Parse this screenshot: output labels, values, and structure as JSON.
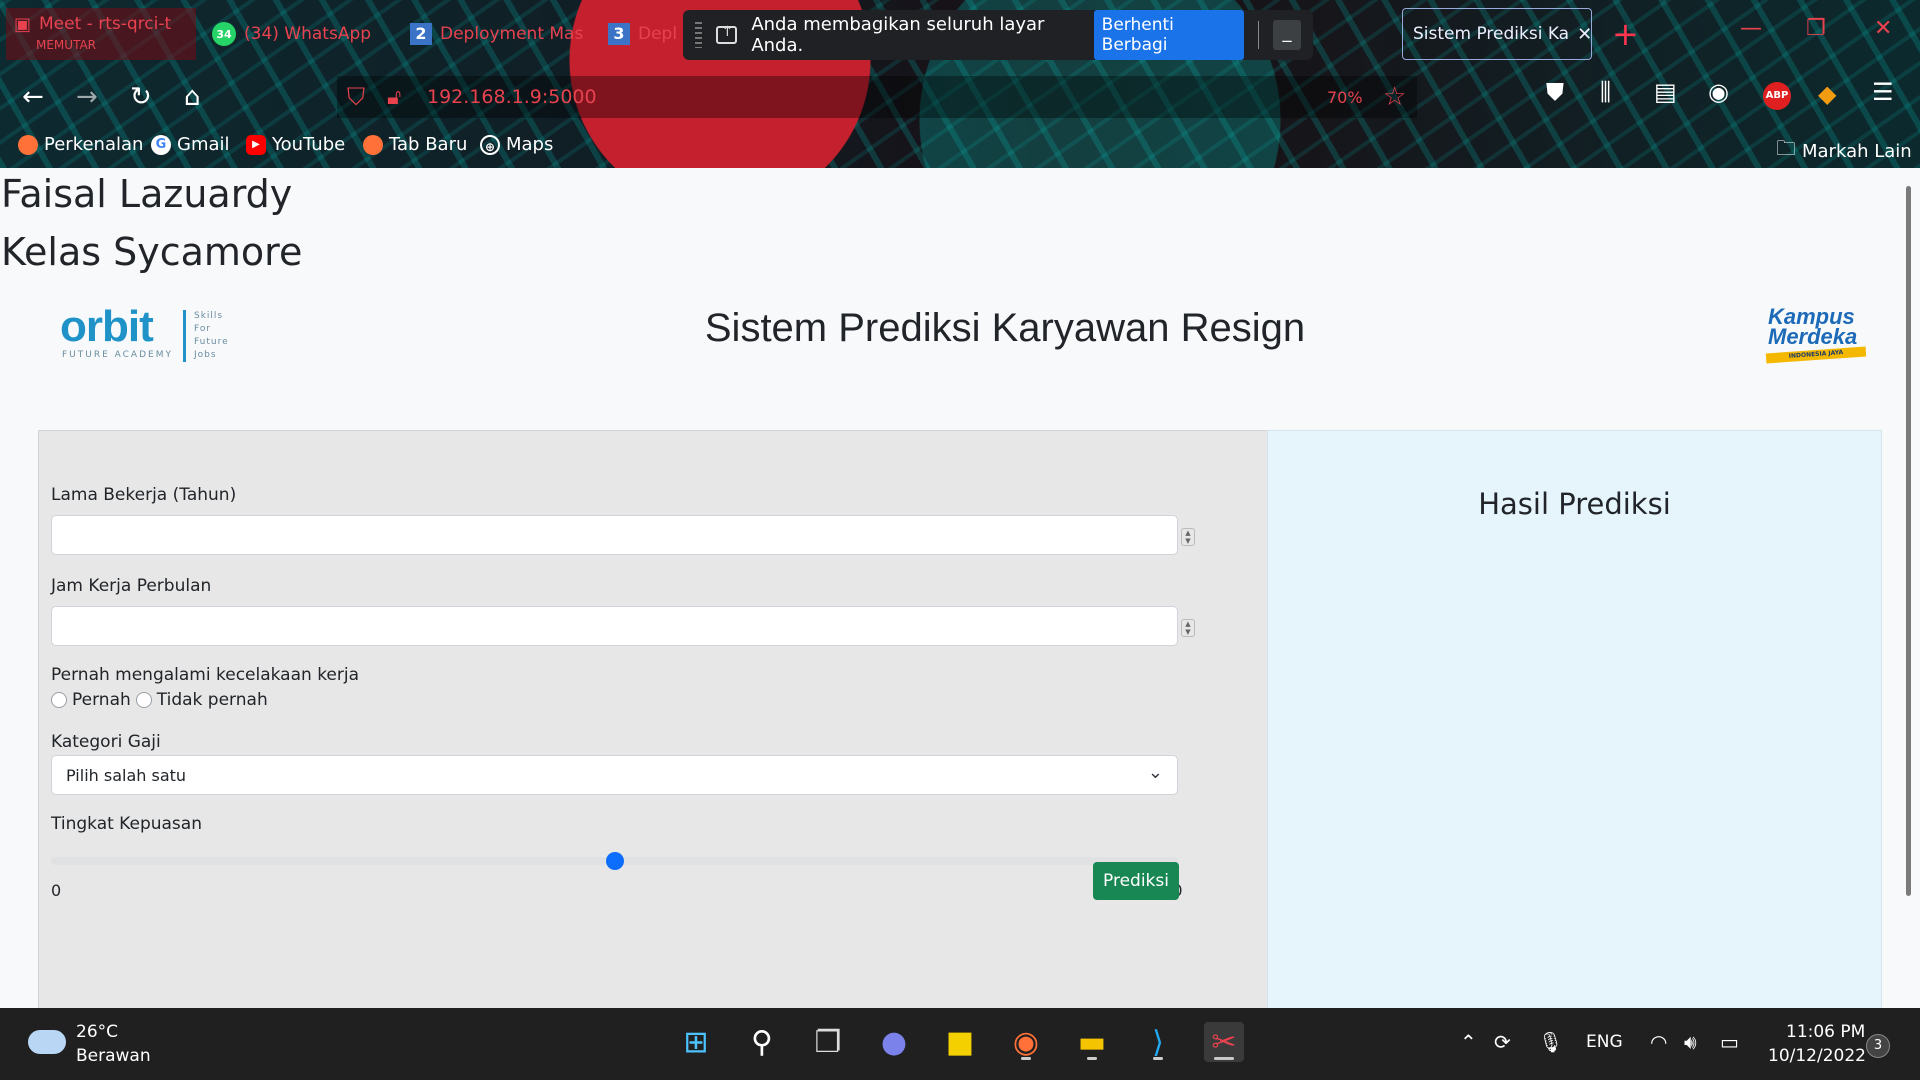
{
  "browser": {
    "tabs": [
      {
        "title": "Meet - rts-qrci-t",
        "subtitle": "MEMUTAR"
      },
      {
        "title": "(34) WhatsApp",
        "badge": "34"
      },
      {
        "title": "Deployment Mas",
        "number": "2"
      },
      {
        "title": "Depl",
        "number": "3"
      },
      {
        "title": "Sistem Prediksi Ka",
        "active": true
      }
    ],
    "share_notice": {
      "message": "Anda membagikan seluruh layar Anda.",
      "stop_label": "Berhenti Berbagi",
      "minimize_label": "_"
    },
    "address": {
      "url": "192.168.1.9:5000",
      "zoom": "70%"
    },
    "bookmarks": [
      {
        "label": "Perkenalan",
        "icon": "firefox-icon"
      },
      {
        "label": "Gmail",
        "icon": "google-icon"
      },
      {
        "label": "YouTube",
        "icon": "youtube-icon"
      },
      {
        "label": "Tab Baru",
        "icon": "firefox-icon"
      },
      {
        "label": "Maps",
        "icon": "globe-icon"
      }
    ],
    "other_bookmarks": "Markah Lain"
  },
  "page": {
    "author_name": "Faisal Lazuardy",
    "author_class": "Kelas Sycamore",
    "title": "Sistem Prediksi Karyawan Resign",
    "logo_left": {
      "word": "orbit",
      "sub": "FUTURE ACADEMY",
      "skills": [
        "Skills",
        "For",
        "Future",
        "Jobs"
      ]
    },
    "logo_right": {
      "line1": "Kampus",
      "line2": "Merdeka",
      "ribbon": "INDONESIA JAYA"
    },
    "form": {
      "tenure_label": "Lama Bekerja (Tahun)",
      "tenure_value": "",
      "hours_label": "Jam Kerja Perbulan",
      "hours_value": "",
      "accident_label": "Pernah mengalami kecelakaan kerja",
      "accident_options": [
        "Pernah",
        "Tidak pernah"
      ],
      "salary_label": "Kategori Gaji",
      "salary_selected": "Pilih salah satu",
      "satisfaction_label": "Tingkat Kepuasan",
      "satisfaction_min": "0",
      "satisfaction_max": "100",
      "satisfaction_value": 50,
      "submit_label": "Prediksi"
    },
    "result_title": "Hasil Prediksi"
  },
  "taskbar": {
    "weather_temp": "26°C",
    "weather_desc": "Berawan",
    "language": "ENG",
    "time": "11:06 PM",
    "date": "10/12/2022",
    "notifications": "3"
  },
  "colors": {
    "accent": "#0d6efd",
    "submit": "#198754",
    "result_bg": "#e6f4fc",
    "form_bg": "#e7e7e7",
    "chrome_red": "#e8424f"
  }
}
